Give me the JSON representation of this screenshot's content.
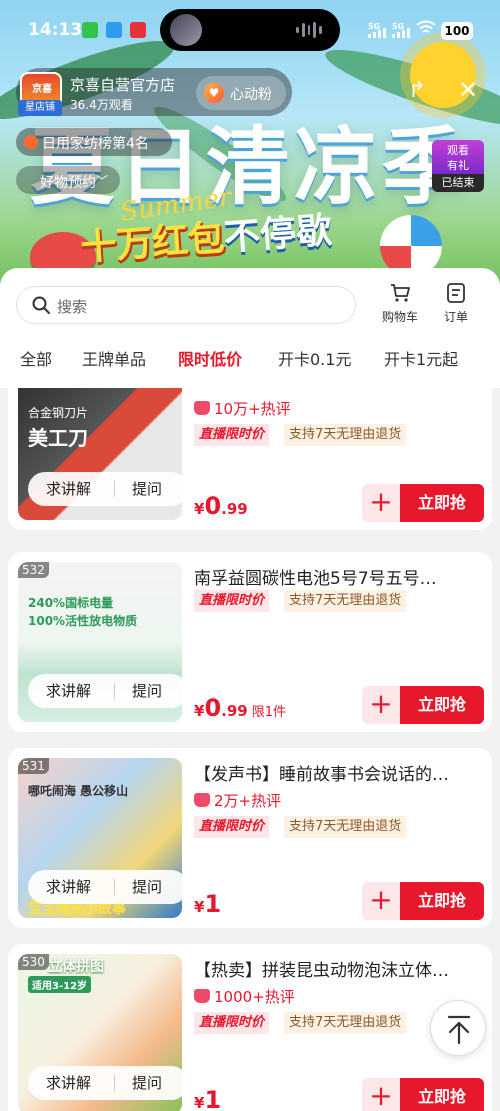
{
  "status_bar": {
    "time": "14:13",
    "battery": "100",
    "sig1": "5G",
    "sig2": "5G"
  },
  "banner": {
    "big_title": "夏日清凉季",
    "summer_script": "Summer",
    "promo_main": "十万红包",
    "promo_tail": "不停歇",
    "replay_label": "观看\n有礼",
    "replay_status": "已结束"
  },
  "shop": {
    "logo_text": "京喜",
    "badge": "星店铺",
    "name": "京喜自营官方店",
    "viewers": "36.4万观看",
    "follow_label": "心动粉",
    "rank": "日用家纺榜第4名",
    "preorder": "好物预约"
  },
  "search": {
    "placeholder": "搜索"
  },
  "toolbar": {
    "cart_label": "购物车",
    "order_label": "订单"
  },
  "tabs": [
    {
      "label": "全部",
      "active": false
    },
    {
      "label": "王牌单品",
      "active": false
    },
    {
      "label": "限时低价",
      "active": true
    },
    {
      "label": "开卡0.1元",
      "active": false
    },
    {
      "label": "开卡1元起",
      "active": false
    }
  ],
  "actions": {
    "explain": "求讲解",
    "ask": "提问",
    "buy": "立即抢",
    "add": "+"
  },
  "products": [
    {
      "num": "",
      "title": "",
      "thumb_caption": "合金钢刀片",
      "thumb_big": "美工刀",
      "hot": "10万+热评",
      "tag_live": "直播限时价",
      "tag_return": "支持7天无理由退货",
      "price_yen": "¥",
      "price_int": "0",
      "price_dec": ".99",
      "limit": ""
    },
    {
      "num": "532",
      "title": "南孚益圆碳性电池5号7号五号…",
      "thumb_caption": "240%国标电量",
      "thumb_big": "100%活性放电物质",
      "hot": "",
      "tag_live": "直播限时价",
      "tag_return": "支持7天无理由退货",
      "price_yen": "¥",
      "price_int": "0",
      "price_dec": ".99",
      "limit": "限1件"
    },
    {
      "num": "531",
      "title": "【发声书】睡前故事书会说话的…",
      "thumb_caption": "哪吒闹海  愚公移山",
      "thumb_big": "宝宝睡前小故事",
      "hot": "2万+热评",
      "tag_live": "直播限时价",
      "tag_return": "支持7天无理由退货",
      "price_yen": "¥",
      "price_int": "1",
      "price_dec": "",
      "limit": ""
    },
    {
      "num": "530",
      "title": "【热卖】拼装昆虫动物泡沫立体…",
      "thumb_caption": "立体拼图",
      "thumb_big": "适用3-12岁",
      "hot": "1000+热评",
      "tag_live": "直播限时价",
      "tag_return": "支持7天无理由退货",
      "price_yen": "¥",
      "price_int": "1",
      "price_dec": "",
      "limit": ""
    }
  ],
  "colors": {
    "accent": "#e8182c",
    "accent_light": "#fde6e8",
    "panel": "#ffffff",
    "list_bg": "#f2f2f2"
  }
}
